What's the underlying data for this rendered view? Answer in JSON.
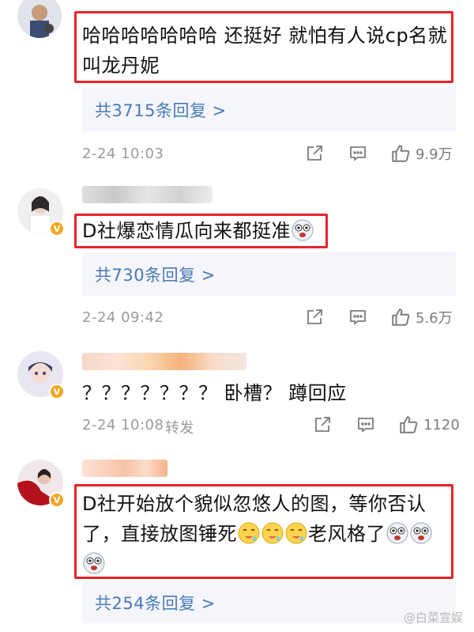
{
  "comments": [
    {
      "body": "哈哈哈哈哈哈哈 还挺好 就怕有人说cp名就叫龙丹妮",
      "body_line1": "哈哈哈哈哈哈哈 还挺好 就怕有人说cp名就",
      "body_line2": "叫龙丹妮",
      "replies": "共3715条回复 >",
      "time": "2-24 10:03",
      "likes": "9.9万"
    },
    {
      "body": "D社爆恋情瓜向来都挺准",
      "replies": "共730条回复 >",
      "time": "2-24 09:42",
      "likes": "5.6万",
      "verified": "V"
    },
    {
      "body": "？？？？？？？ 卧槽？ 蹲回应",
      "time": "2-24 10:08",
      "forward": "转发",
      "likes": "1120",
      "verified": "V"
    },
    {
      "body_line1": "D社开始放个貌似忽悠人的图，等你否认",
      "body_line2a": "了，直接放图锤死",
      "body_line2b": "老风格了",
      "replies": "共254条回复 >",
      "verified": "V"
    }
  ],
  "icons": [
    "share-icon",
    "comment-icon",
    "like-icon",
    "scared-emoji",
    "drooling-emoji"
  ],
  "colors": {
    "highlight_border": "#e8242b",
    "reply_link": "#4a79b8",
    "verified": "#f5a623"
  },
  "watermark": "@白菜宣娱"
}
